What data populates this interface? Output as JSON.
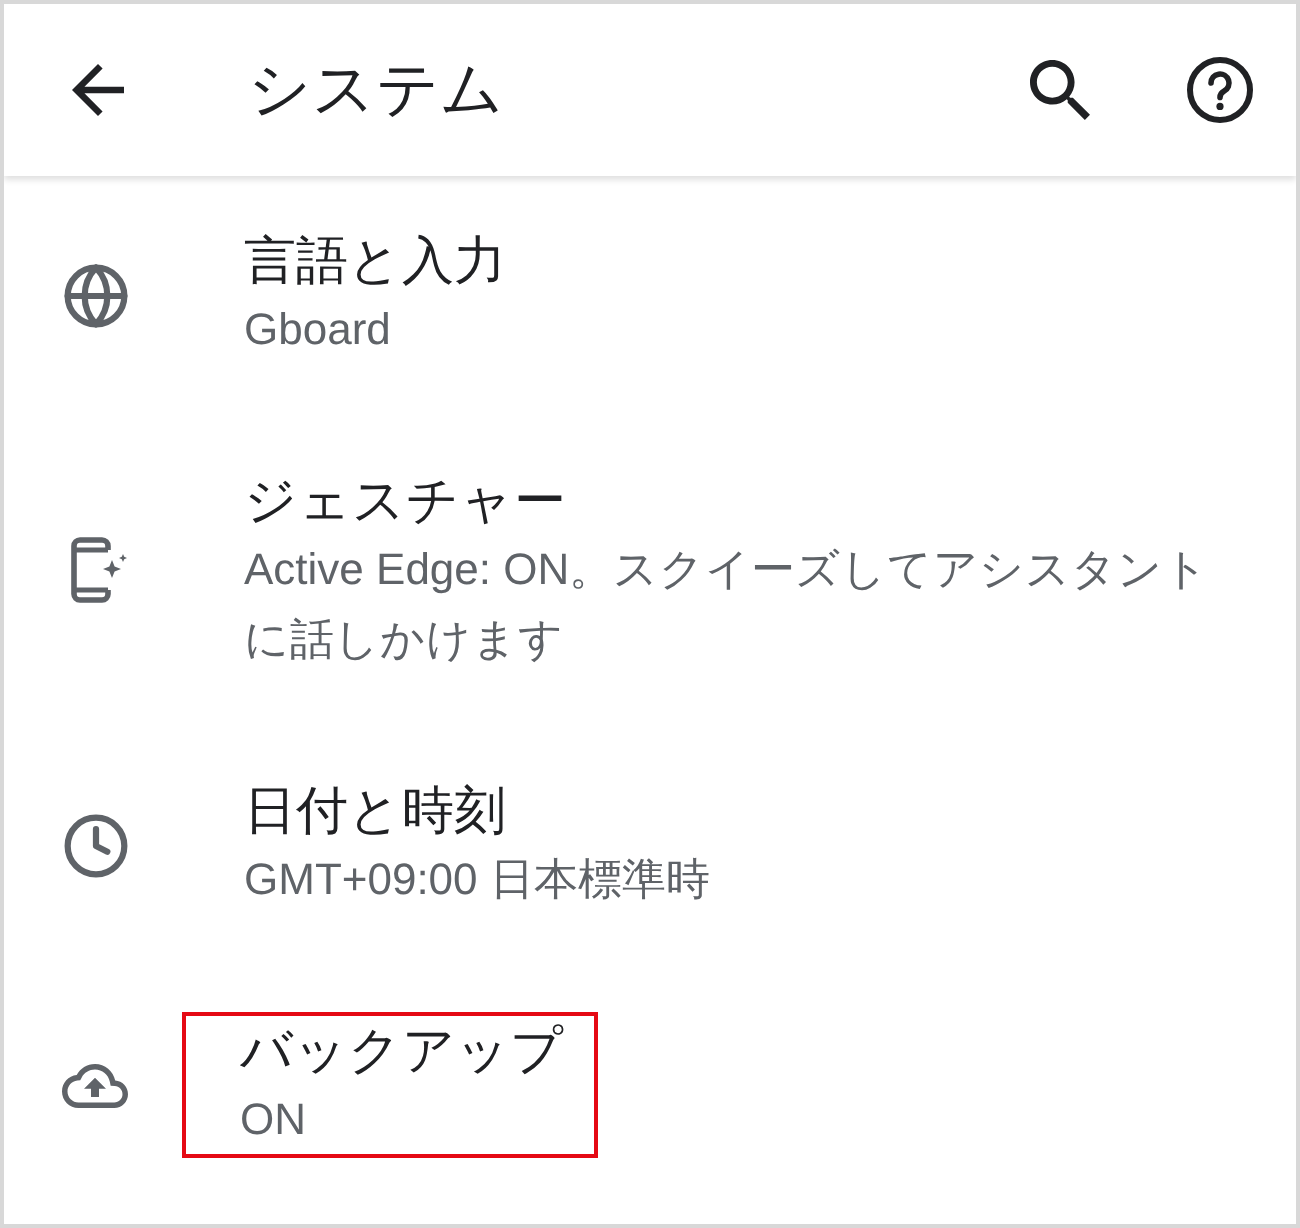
{
  "app_bar": {
    "title": "システム"
  },
  "items": [
    {
      "title": "言語と入力",
      "summary": "Gboard",
      "highlighted": false
    },
    {
      "title": "ジェスチャー",
      "summary": "Active Edge: ON。スクイーズしてアシスタントに話しかけます",
      "highlighted": false
    },
    {
      "title": "日付と時刻",
      "summary": "GMT+09:00 日本標準時",
      "highlighted": false
    },
    {
      "title": "バックアップ",
      "summary": "ON",
      "highlighted": true
    }
  ]
}
